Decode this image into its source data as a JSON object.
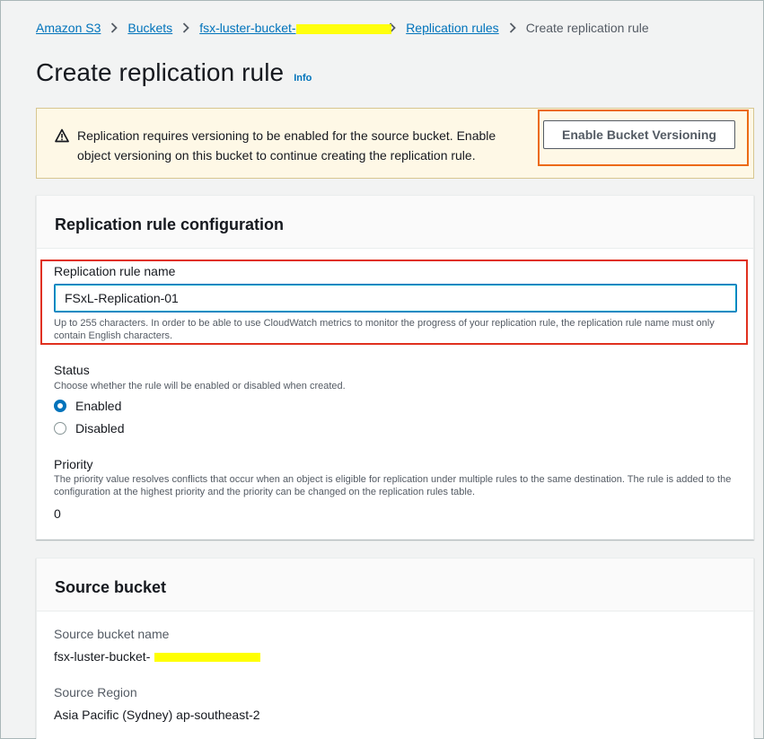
{
  "breadcrumb": {
    "items": [
      "Amazon S3",
      "Buckets",
      "fsx-luster-bucket-",
      "Replication rules"
    ],
    "current": "Create replication rule"
  },
  "page": {
    "title": "Create replication rule",
    "info_label": "Info"
  },
  "alert": {
    "icon": "warning-icon",
    "message": "Replication requires versioning to be enabled for the source bucket. Enable object versioning on this bucket to continue creating the replication rule.",
    "button_label": "Enable Bucket Versioning"
  },
  "rule_config": {
    "header": "Replication rule configuration",
    "name_label": "Replication rule name",
    "name_value": "FSxL-Replication-01",
    "name_hint": "Up to 255 characters. In order to be able to use CloudWatch metrics to monitor the progress of your replication rule, the replication rule name must only contain English characters.",
    "status_label": "Status",
    "status_desc": "Choose whether the rule will be enabled or disabled when created.",
    "status_options": [
      "Enabled",
      "Disabled"
    ],
    "status_selected": "Enabled",
    "priority_label": "Priority",
    "priority_desc": "The priority value resolves conflicts that occur when an object is eligible for replication under multiple rules to the same destination. The rule is added to the configuration at the highest priority and the priority can be changed on the replication rules table.",
    "priority_value": "0"
  },
  "source_bucket": {
    "header": "Source bucket",
    "name_label": "Source bucket name",
    "name_value": "fsx-luster-bucket-",
    "region_label": "Source Region",
    "region_value": "Asia Pacific (Sydney) ap-southeast-2"
  },
  "colors": {
    "link": "#0073bb",
    "warning_bg": "#fef8e6",
    "highlight_orange": "#ec6a14",
    "highlight_red": "#e0301e",
    "redaction": "#ffff00"
  }
}
